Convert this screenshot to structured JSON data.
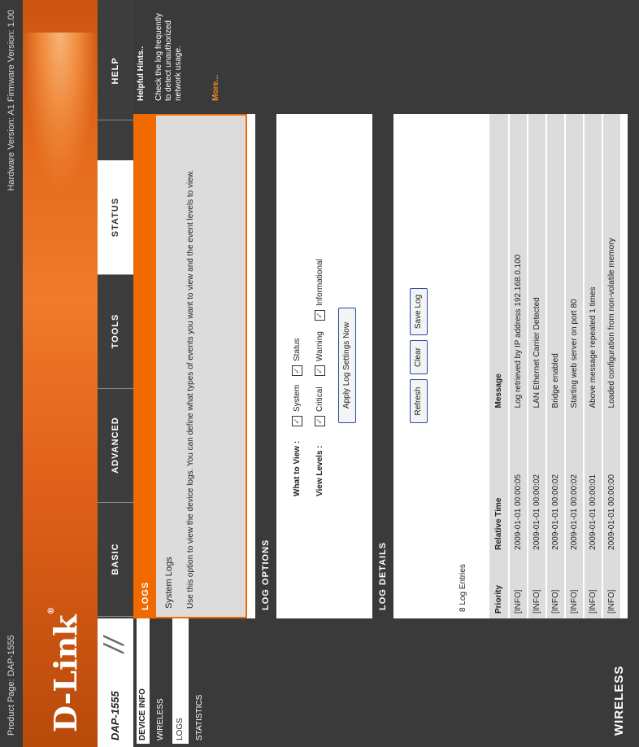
{
  "header": {
    "product_page": "Product Page: DAP-1555",
    "version": "Hardware Version: A1   Firmware Version: 1.00"
  },
  "brand": {
    "logo": "D-Link",
    "model": "DAP-1555",
    "footer": "WIRELESS"
  },
  "nav": {
    "tabs": [
      "BASIC",
      "ADVANCED",
      "TOOLS",
      "STATUS",
      "HELP"
    ],
    "active": "STATUS"
  },
  "sidebar": {
    "title": "DEVICE INFO",
    "items": [
      "WIRELESS",
      "LOGS",
      "STATISTICS"
    ]
  },
  "logs": {
    "header": "LOGS",
    "title": "System Logs",
    "description": "Use this option to view the device logs. You can define what types of events you want to view and the event levels to view."
  },
  "log_options": {
    "header": "LOG OPTIONS",
    "what_to_view_label": "What to View :",
    "what_to_view": [
      "System",
      "Status"
    ],
    "view_levels_label": "View Levels :",
    "view_levels": [
      "Critical",
      "Warning",
      "Informational"
    ],
    "apply_button": "Apply Log Settings Now"
  },
  "log_details": {
    "header": "LOG DETAILS",
    "buttons": [
      "Refresh",
      "Clear",
      "Save Log"
    ],
    "count_label": "8 Log Entries",
    "columns": [
      "Priority",
      "Relative Time",
      "Message"
    ],
    "rows": [
      [
        "[INFO]",
        "2009-01-01 00:00:05",
        "Log retrieved by IP address 192.168.0.100"
      ],
      [
        "[INFO]",
        "2009-01-01 00:00:02",
        "LAN Ethernet Carrier Detected"
      ],
      [
        "[INFO]",
        "2009-01-01 00:00:02",
        "Bridge enabled"
      ],
      [
        "[INFO]",
        "2009-01-01 00:00:02",
        "Starting web server on port 80"
      ],
      [
        "[INFO]",
        "2009-01-01 00:00:01",
        "Above message repeated 1 times"
      ],
      [
        "[INFO]",
        "2009-01-01 00:00:00",
        "Loaded configuration from non-volatile memory"
      ]
    ]
  },
  "help": {
    "title": "Helpful Hints..",
    "text": "Check the log frequently to detect unauthorized network usage.",
    "more": "More..."
  },
  "colors": {
    "accent": "#f06a00",
    "dark": "#3a3a3a"
  }
}
